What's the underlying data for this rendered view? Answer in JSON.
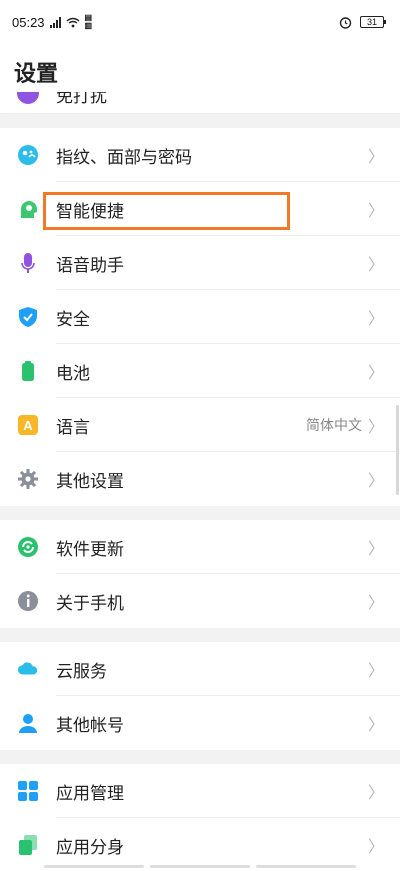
{
  "status": {
    "time": "05:23",
    "battery": "31"
  },
  "title": "设置",
  "partial_item": {
    "label": "免打扰",
    "icon": "moon-icon"
  },
  "groups": [
    {
      "items": [
        {
          "label": "指纹、面部与密码",
          "icon": "fingerprint-face-icon",
          "color": "#2bbdea"
        },
        {
          "label": "智能便捷",
          "icon": "smart-head-icon",
          "color": "#3dc772"
        },
        {
          "label": "语音助手",
          "icon": "microphone-icon",
          "color": "#8f55e0"
        },
        {
          "label": "安全",
          "icon": "shield-check-icon",
          "color": "#1f9ff5"
        },
        {
          "label": "电池",
          "icon": "battery-icon",
          "color": "#2bc26f"
        },
        {
          "label": "语言",
          "icon": "language-a-icon",
          "color": "#f7b728",
          "value": "简体中文"
        },
        {
          "label": "其他设置",
          "icon": "gear-icon",
          "color": "#8a8f99"
        }
      ]
    },
    {
      "items": [
        {
          "label": "软件更新",
          "icon": "update-icon",
          "color": "#2bc26f"
        },
        {
          "label": "关于手机",
          "icon": "info-icon",
          "color": "#8a8f99"
        }
      ]
    },
    {
      "items": [
        {
          "label": "云服务",
          "icon": "cloud-icon",
          "color": "#2bbdea"
        },
        {
          "label": "其他帐号",
          "icon": "person-icon",
          "color": "#1f9ff5"
        }
      ]
    },
    {
      "items": [
        {
          "label": "应用管理",
          "icon": "app-grid-icon",
          "color": "#1f9ff5"
        },
        {
          "label": "应用分身",
          "icon": "app-clone-icon",
          "color": "#2bc26f"
        }
      ]
    }
  ],
  "chevron": "〉",
  "highlight_color": "#f07a26"
}
